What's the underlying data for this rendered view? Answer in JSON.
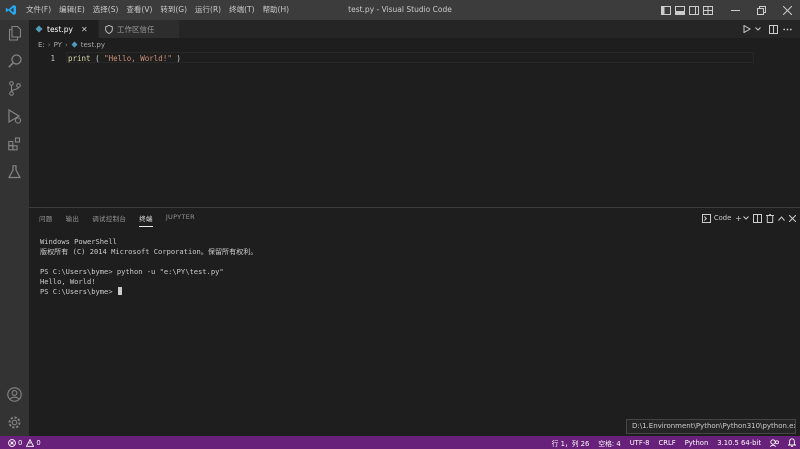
{
  "titlebar": {
    "title": "test.py - Visual Studio Code",
    "menu": [
      "文件(F)",
      "编辑(E)",
      "选择(S)",
      "查看(V)",
      "转到(G)",
      "运行(R)",
      "终端(T)",
      "帮助(H)"
    ]
  },
  "tabs": [
    {
      "label": "test.py",
      "icon": "python-file-icon"
    },
    {
      "label": "工作区信任",
      "icon": "shield-icon"
    }
  ],
  "breadcrumb": [
    "E:",
    "PY",
    "test.py"
  ],
  "editor": {
    "line_number": "1",
    "code": {
      "fn": "print",
      "open": " ( ",
      "str": "\"Hello, World!\"",
      "close": " )"
    }
  },
  "panel": {
    "tabs": [
      "问题",
      "输出",
      "调试控制台",
      "终端",
      "JUPYTER"
    ],
    "active_tab": 3,
    "terminal_profile": "Code",
    "terminal_lines": [
      "Windows PowerShell",
      "版权所有 (C) 2014 Microsoft Corporation。保留所有权利。",
      "",
      "PS C:\\Users\\byme> python -u \"e:\\PY\\test.py\"",
      "Hello, World!",
      "PS C:\\Users\\byme> "
    ]
  },
  "tooltip": "D:\\1.Environment\\Python\\Python310\\python.exe",
  "statusbar": {
    "errors": "0",
    "warnings": "0",
    "position": "行 1，列 26",
    "spaces": "空格: 4",
    "encoding": "UTF-8",
    "eol": "CRLF",
    "language": "Python",
    "interpreter": "3.10.5 64-bit"
  },
  "colors": {
    "statusbar": "#68217a",
    "titlebar": "#3c3c3c",
    "activitybar": "#333333",
    "editor_bg": "#1e1e1e",
    "python_icon": "#519aba",
    "vscode_logo": "#23a9f2"
  }
}
